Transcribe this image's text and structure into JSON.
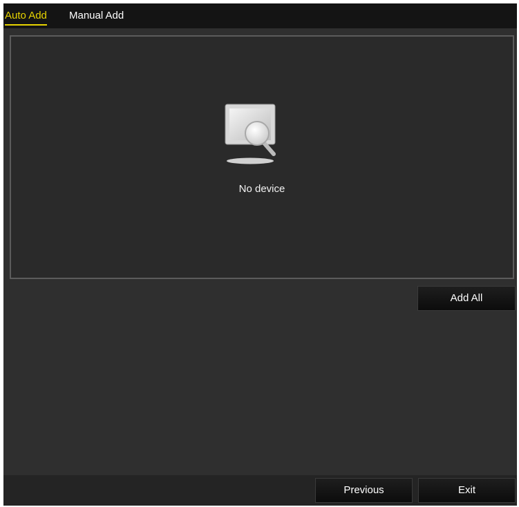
{
  "tabs": {
    "auto_add": "Auto Add",
    "manual_add": "Manual Add",
    "active": "auto_add"
  },
  "device_list": {
    "empty_icon": "monitor-search-icon",
    "empty_message": "No device"
  },
  "actions": {
    "add_all_label": "Add All"
  },
  "footer": {
    "previous_label": "Previous",
    "exit_label": "Exit"
  },
  "colors": {
    "active_tab": "#e8d400",
    "background": "#2f2f2f",
    "tab_bar": "#141414"
  }
}
